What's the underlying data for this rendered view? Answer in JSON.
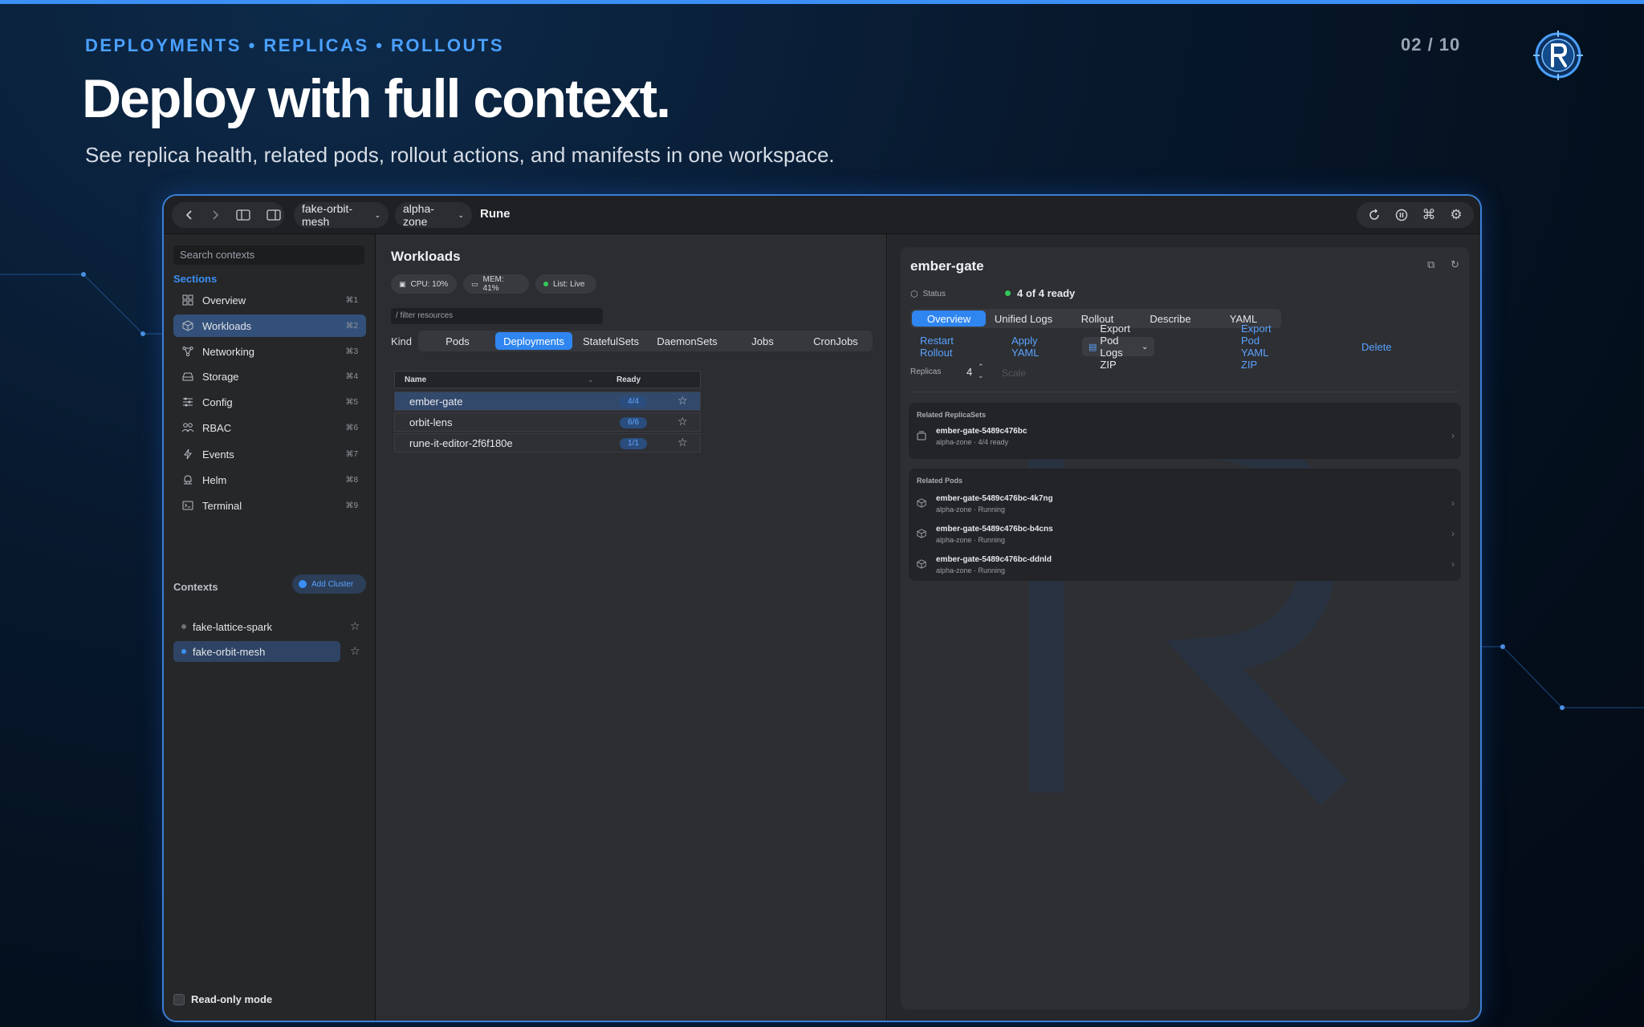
{
  "slide": {
    "eyebrow": "DEPLOYMENTS • REPLICAS • ROLLOUTS",
    "pager": "02 / 10",
    "headline": "Deploy with full context.",
    "subhead": "See replica health, related pods, rollout actions, and manifests in one workspace.",
    "accent": "#3b8ff5"
  },
  "titlebar": {
    "context_select": "fake-orbit-mesh",
    "namespace_select": "alpha-zone",
    "app_name": "Rune",
    "icons": [
      "chevron-left-icon",
      "chevron-right-icon",
      "sidebar-left-icon",
      "sidebar-right-icon",
      "refresh-icon",
      "pause-icon",
      "command-icon",
      "gear-icon"
    ]
  },
  "sidebar": {
    "search_placeholder": "Search contexts",
    "sections_label": "Sections",
    "items": [
      {
        "label": "Overview",
        "shortcut": "⌘1",
        "icon": "grid-icon"
      },
      {
        "label": "Workloads",
        "shortcut": "⌘2",
        "icon": "cube-icon"
      },
      {
        "label": "Networking",
        "shortcut": "⌘3",
        "icon": "network-icon"
      },
      {
        "label": "Storage",
        "shortcut": "⌘4",
        "icon": "drive-icon"
      },
      {
        "label": "Config",
        "shortcut": "⌘5",
        "icon": "sliders-icon"
      },
      {
        "label": "RBAC",
        "shortcut": "⌘6",
        "icon": "users-icon"
      },
      {
        "label": "Events",
        "shortcut": "⌘7",
        "icon": "bolt-icon"
      },
      {
        "label": "Helm",
        "shortcut": "⌘8",
        "icon": "helm-icon"
      },
      {
        "label": "Terminal",
        "shortcut": "⌘9",
        "icon": "terminal-icon"
      }
    ],
    "active_index": 1,
    "contexts_label": "Contexts",
    "add_cluster": "Add Cluster",
    "contexts": [
      {
        "label": "fake-lattice-spark",
        "active": false
      },
      {
        "label": "fake-orbit-mesh",
        "active": true
      }
    ],
    "readonly_label": "Read-only mode"
  },
  "workloads": {
    "title": "Workloads",
    "chips": [
      "CPU: 10%",
      "MEM: 41%",
      "List: Live"
    ],
    "filter_placeholder": "/ filter resources",
    "kind_label": "Kind",
    "tabs": [
      "Pods",
      "Deployments",
      "StatefulSets",
      "DaemonSets",
      "Jobs",
      "CronJobs"
    ],
    "active_tab": 1,
    "table": {
      "headers": [
        "Name",
        "Ready"
      ],
      "rows": [
        {
          "name": "ember-gate",
          "ready": "4/4"
        },
        {
          "name": "orbit-lens",
          "ready": "6/6"
        },
        {
          "name": "rune-it-editor-2f6f180e",
          "ready": "1/1"
        }
      ]
    }
  },
  "detail": {
    "title": "ember-gate",
    "status_label": "Status",
    "status_value": "4 of 4 ready",
    "status_color": "#34c759",
    "tabs": [
      "Overview",
      "Unified Logs",
      "Rollout",
      "Describe",
      "YAML"
    ],
    "active_tab": 0,
    "actions": [
      "Restart Rollout",
      "Apply YAML",
      "Export Pod Logs ZIP",
      "Export Pod YAML ZIP",
      "Delete"
    ],
    "replicas_label": "Replicas",
    "replicas_value": "4",
    "scale_label": "Scale",
    "related_replicasets_label": "Related ReplicaSets",
    "replicasets": [
      {
        "name": "ember-gate-5489c476bc",
        "sub": "alpha-zone · 4/4 ready"
      }
    ],
    "related_pods_label": "Related Pods",
    "pods": [
      {
        "name": "ember-gate-5489c476bc-4k7ng",
        "sub": "alpha-zone · Running"
      },
      {
        "name": "ember-gate-5489c476bc-b4cns",
        "sub": "alpha-zone · Running"
      },
      {
        "name": "ember-gate-5489c476bc-ddnld",
        "sub": "alpha-zone · Running"
      }
    ]
  }
}
